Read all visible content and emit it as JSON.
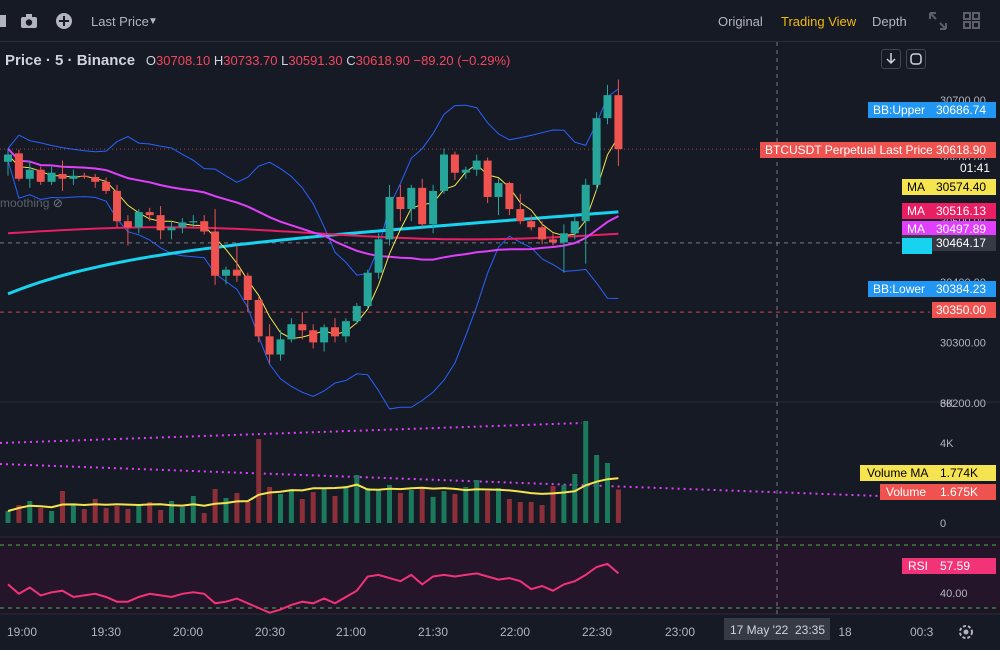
{
  "toolbar": {
    "price_type": "Last Price",
    "views": [
      "Original",
      "Trading View",
      "Depth"
    ],
    "active_view": "Trading View"
  },
  "legend": {
    "symbol": "Price · 5 · Binance",
    "o_label": "O",
    "o": "30708.10",
    "h_label": "H",
    "h": "30733.70",
    "l_label": "L",
    "l": "30591.30",
    "c_label": "C",
    "c": "30618.90",
    "change": "−89.20 (−0.29%)",
    "smoothing": "moothing"
  },
  "colors": {
    "up": "#26a69a",
    "down": "#ef5350",
    "bb": "#2962ff",
    "ma_yellow": "#f5e44f",
    "ma_red": "#e91e63",
    "ma_magenta": "#e040fb",
    "ma_cyan": "#18d3f0",
    "rsi": "#f23378",
    "accent": "#f0b90b"
  },
  "chart_data": [
    {
      "type": "candlestick",
      "x_labels": [
        "19:00",
        "19:30",
        "20:00",
        "20:30",
        "21:00",
        "21:30",
        "22:00",
        "22:30",
        "23:00"
      ],
      "time_footer": {
        "date": "17 May '22",
        "time": "23:35",
        "day": "18",
        "tail": "00:3"
      },
      "y_ticks": [
        30700.0,
        30600.0,
        30500.0,
        30400.0,
        30300.0,
        30200.0
      ],
      "ylim": [
        30200,
        30740
      ],
      "ohlc": [
        [
          30598,
          30620,
          30575,
          30610
        ],
        [
          30612,
          30618,
          30566,
          30570
        ],
        [
          30570,
          30600,
          30555,
          30585
        ],
        [
          30585,
          30590,
          30560,
          30565
        ],
        [
          30565,
          30590,
          30560,
          30580
        ],
        [
          30578,
          30600,
          30550,
          30570
        ],
        [
          30570,
          30585,
          30560,
          30575
        ],
        [
          30575,
          30580,
          30570,
          30573
        ],
        [
          30573,
          30578,
          30555,
          30565
        ],
        [
          30565,
          30572,
          30545,
          30550
        ],
        [
          30550,
          30560,
          30490,
          30500
        ],
        [
          30500,
          30510,
          30460,
          30490
        ],
        [
          30490,
          30520,
          30480,
          30515
        ],
        [
          30515,
          30522,
          30500,
          30510
        ],
        [
          30510,
          30525,
          30470,
          30485
        ],
        [
          30485,
          30500,
          30470,
          30490
        ],
        [
          30490,
          30505,
          30480,
          30498
        ],
        [
          30498,
          30510,
          30490,
          30500
        ],
        [
          30500,
          30510,
          30478,
          30483
        ],
        [
          30483,
          30520,
          30395,
          30410
        ],
        [
          30410,
          30425,
          30396,
          30420
        ],
        [
          30420,
          30460,
          30400,
          30410
        ],
        [
          30410,
          30415,
          30350,
          30370
        ],
        [
          30370,
          30375,
          30300,
          30310
        ],
        [
          30310,
          30330,
          30265,
          30280
        ],
        [
          30280,
          30320,
          30270,
          30305
        ],
        [
          30305,
          30340,
          30300,
          30330
        ],
        [
          30330,
          30350,
          30305,
          30320
        ],
        [
          30320,
          30330,
          30290,
          30300
        ],
        [
          30300,
          30330,
          30285,
          30325
        ],
        [
          30325,
          30340,
          30300,
          30310
        ],
        [
          30310,
          30340,
          30300,
          30335
        ],
        [
          30335,
          30365,
          30330,
          30360
        ],
        [
          30360,
          30420,
          30355,
          30415
        ],
        [
          30415,
          30480,
          30405,
          30470
        ],
        [
          30470,
          30560,
          30460,
          30540
        ],
        [
          30540,
          30560,
          30500,
          30520
        ],
        [
          30520,
          30560,
          30500,
          30555
        ],
        [
          30555,
          30570,
          30490,
          30495
        ],
        [
          30495,
          30560,
          30480,
          30550
        ],
        [
          30550,
          30620,
          30545,
          30610
        ],
        [
          30610,
          30615,
          30568,
          30580
        ],
        [
          30580,
          30590,
          30570,
          30585
        ],
        [
          30585,
          30610,
          30575,
          30600
        ],
        [
          30600,
          30605,
          30530,
          30540
        ],
        [
          30540,
          30570,
          30510,
          30563
        ],
        [
          30563,
          30565,
          30510,
          30520
        ],
        [
          30520,
          30545,
          30495,
          30500
        ],
        [
          30500,
          30510,
          30485,
          30490
        ],
        [
          30490,
          30500,
          30462,
          30470
        ],
        [
          30470,
          30480,
          30460,
          30465
        ],
        [
          30465,
          30495,
          30415,
          30480
        ],
        [
          30480,
          30510,
          30470,
          30500
        ],
        [
          30500,
          30570,
          30430,
          30560
        ],
        [
          30560,
          30680,
          30550,
          30670
        ],
        [
          30670,
          30725,
          30660,
          30708
        ],
        [
          30708,
          30733.7,
          30591.3,
          30618.9
        ]
      ],
      "overlays": [
        {
          "name": "BB:Upper",
          "value": "30686.74"
        },
        {
          "name": "BTCUSDT Perpetual Last Price",
          "value": "30618.90",
          "countdown": "01:41"
        },
        {
          "name": "MA",
          "value": "30574.40"
        },
        {
          "name": "MA",
          "value": "30516.13"
        },
        {
          "name": "MA",
          "value": "30497.89"
        },
        {
          "name": "MA",
          "value": "30464.17"
        },
        {
          "name": "BB:Lower",
          "value": "30384.23"
        },
        {
          "name": "",
          "value": "30350.00"
        }
      ]
    },
    {
      "type": "bar",
      "y_ticks": [
        "6K",
        "4K",
        "2K",
        "0"
      ],
      "ylim": [
        0,
        6000
      ],
      "values": [
        600,
        900,
        1100,
        750,
        600,
        1600,
        950,
        700,
        1200,
        750,
        850,
        700,
        900,
        1050,
        650,
        1100,
        800,
        1350,
        500,
        1700,
        1250,
        1500,
        1050,
        4200,
        1800,
        1450,
        1650,
        1200,
        1550,
        1750,
        1350,
        1850,
        2400,
        1750,
        1700,
        1900,
        1500,
        1650,
        1800,
        1300,
        1600,
        1450,
        1800,
        2150,
        1600,
        1750,
        1200,
        1050,
        1050,
        900,
        1850,
        1900,
        2450,
        5100,
        3400,
        3000,
        1675
      ],
      "labels": [
        {
          "name": "Volume MA",
          "value": "1.774K"
        },
        {
          "name": "Volume",
          "value": "1.675K"
        }
      ]
    },
    {
      "type": "line",
      "name": "RSI",
      "values": [
        45,
        39,
        43,
        38,
        40,
        41,
        37,
        38,
        39,
        37,
        34,
        34,
        37,
        39,
        38,
        37,
        39,
        40,
        39,
        33,
        34,
        36,
        33,
        30,
        27,
        29,
        32,
        34,
        33,
        36,
        33,
        37,
        41,
        50,
        51,
        49,
        47,
        51,
        45,
        50,
        51,
        50,
        51,
        52,
        50,
        48,
        49,
        47,
        42,
        44,
        41,
        45,
        47,
        51,
        56,
        58,
        52
      ],
      "value_label": "57.59",
      "y_ticks": [
        "40.00"
      ]
    }
  ]
}
